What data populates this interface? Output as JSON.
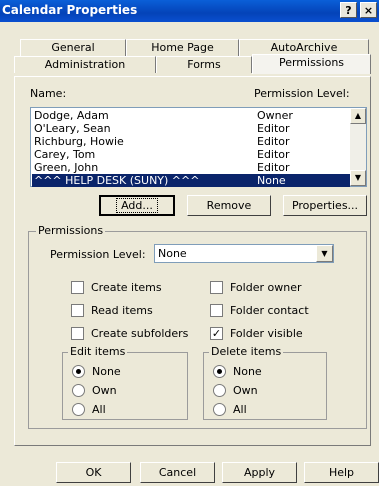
{
  "window": {
    "title": "Calendar Properties",
    "help_btn": "?",
    "close_btn": "×"
  },
  "tabs": {
    "row1": [
      "General",
      "Home Page",
      "AutoArchive"
    ],
    "row2": [
      "Administration",
      "Forms",
      "Permissions"
    ]
  },
  "list": {
    "name_header": "Name:",
    "level_header": "Permission Level:",
    "rows": [
      {
        "name": "Dodge, Adam",
        "level": "Owner"
      },
      {
        "name": "O'Leary, Sean",
        "level": "Editor"
      },
      {
        "name": "Richburg, Howie",
        "level": "Editor"
      },
      {
        "name": "Carey, Tom",
        "level": "Editor"
      },
      {
        "name": "Green, John",
        "level": "Editor"
      },
      {
        "name": "^^^ HELP DESK (SUNY) ^^^",
        "level": "None"
      }
    ]
  },
  "actions": {
    "add": "Add...",
    "remove": "Remove",
    "properties": "Properties..."
  },
  "permissions": {
    "group_label": "Permissions",
    "level_label": "Permission Level:",
    "level_value": "None",
    "checks": {
      "create_items": {
        "label": "Create items",
        "checked": false
      },
      "read_items": {
        "label": "Read items",
        "checked": false
      },
      "create_subfolders": {
        "label": "Create subfolders",
        "checked": false
      },
      "folder_owner": {
        "label": "Folder owner",
        "checked": false
      },
      "folder_contact": {
        "label": "Folder contact",
        "checked": false
      },
      "folder_visible": {
        "label": "Folder visible",
        "checked": true
      }
    },
    "edit_items": {
      "label": "Edit items",
      "options": [
        "None",
        "Own",
        "All"
      ],
      "selected": "None"
    },
    "delete_items": {
      "label": "Delete items",
      "options": [
        "None",
        "Own",
        "All"
      ],
      "selected": "None"
    }
  },
  "footer": {
    "ok": "OK",
    "cancel": "Cancel",
    "apply": "Apply",
    "help": "Help"
  }
}
